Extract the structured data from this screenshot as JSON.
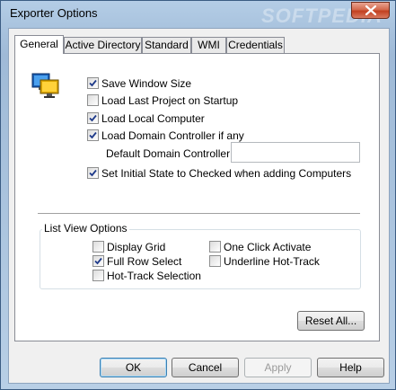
{
  "window": {
    "title": "Exporter Options",
    "watermark": "SOFTPEDIA"
  },
  "tabs": [
    {
      "label": "General",
      "active": true
    },
    {
      "label": "Active Directory",
      "active": false
    },
    {
      "label": "Standard",
      "active": false
    },
    {
      "label": "WMI",
      "active": false
    },
    {
      "label": "Credentials",
      "active": false
    }
  ],
  "general": {
    "save_window_size": {
      "label": "Save Window Size",
      "checked": true
    },
    "load_last_project": {
      "label": "Load Last Project on Startup",
      "checked": false
    },
    "load_local_computer": {
      "label": "Load Local Computer",
      "checked": true
    },
    "load_domain_controller": {
      "label": "Load Domain Controller if any",
      "checked": true
    },
    "default_dc_label": "Default Domain Controller:",
    "default_dc_value": "",
    "initial_state_checked": {
      "label": "Set Initial State to Checked when adding Computers",
      "checked": true
    }
  },
  "list_view": {
    "title": "List View Options",
    "display_grid": {
      "label": "Display Grid",
      "checked": false
    },
    "full_row_select": {
      "label": "Full Row Select",
      "checked": true
    },
    "hot_track_selection": {
      "label": "Hot-Track Selection",
      "checked": false
    },
    "one_click_activate": {
      "label": "One Click Activate",
      "checked": false
    },
    "underline_hot_track": {
      "label": "Underline Hot-Track",
      "checked": false
    }
  },
  "buttons": {
    "reset_all": "Reset All...",
    "ok": "OK",
    "cancel": "Cancel",
    "apply": "Apply",
    "help": "Help"
  },
  "icons": {
    "app": "monitors-icon",
    "close": "close-icon",
    "check": "checkmark-icon"
  },
  "colors": {
    "title_bar": "#a9c3de",
    "close_button": "#c2401f",
    "default_button_border": "#3c7fb1"
  }
}
